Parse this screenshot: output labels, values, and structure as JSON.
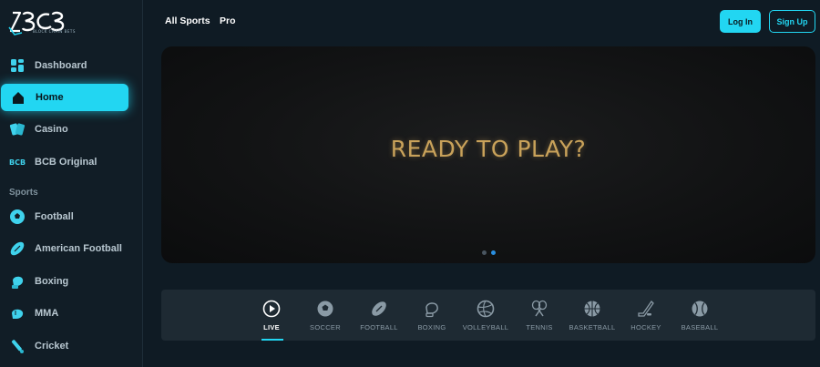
{
  "brand": {
    "logo_text": "BCB",
    "tagline": "BLOCK CHAIN BETS"
  },
  "sidebar": {
    "items": [
      {
        "label": "Dashboard",
        "icon": "grid-icon"
      },
      {
        "label": "Home",
        "icon": "home-icon",
        "active": true
      },
      {
        "label": "Casino",
        "icon": "cards-icon"
      },
      {
        "label": "BCB Original",
        "icon": "bcb-logo-icon"
      }
    ],
    "section_label": "Sports",
    "sports": [
      {
        "label": "Football",
        "icon": "soccer-ball-icon"
      },
      {
        "label": "American Football",
        "icon": "american-football-icon"
      },
      {
        "label": "Boxing",
        "icon": "boxing-glove-icon"
      },
      {
        "label": "MMA",
        "icon": "mma-glove-icon"
      },
      {
        "label": "Cricket",
        "icon": "cricket-bat-icon"
      }
    ]
  },
  "header": {
    "links": [
      "All Sports",
      "Pro"
    ],
    "login_label": "Log In",
    "signup_label": "Sign Up"
  },
  "banner": {
    "headline": "READY TO PLAY?",
    "slides": 2,
    "active_slide": 2
  },
  "sports_tabs": [
    {
      "label": "LIVE",
      "icon": "play-icon",
      "active": true
    },
    {
      "label": "SOCCER",
      "icon": "soccer-ball-icon"
    },
    {
      "label": "FOOTBALL",
      "icon": "american-football-icon"
    },
    {
      "label": "BOXING",
      "icon": "boxing-glove-icon"
    },
    {
      "label": "VOLLEYBALL",
      "icon": "volleyball-icon"
    },
    {
      "label": "TENNIS",
      "icon": "tennis-rackets-icon"
    },
    {
      "label": "BASKETBALL",
      "icon": "basketball-icon"
    },
    {
      "label": "HOCKEY",
      "icon": "hockey-stick-icon"
    },
    {
      "label": "BASEBALL",
      "icon": "baseball-icon"
    }
  ],
  "colors": {
    "accent": "#22d6f2",
    "sidebar_bg": "#111d26",
    "page_bg": "#0f1b24",
    "banner_text": "#c9a25a"
  }
}
